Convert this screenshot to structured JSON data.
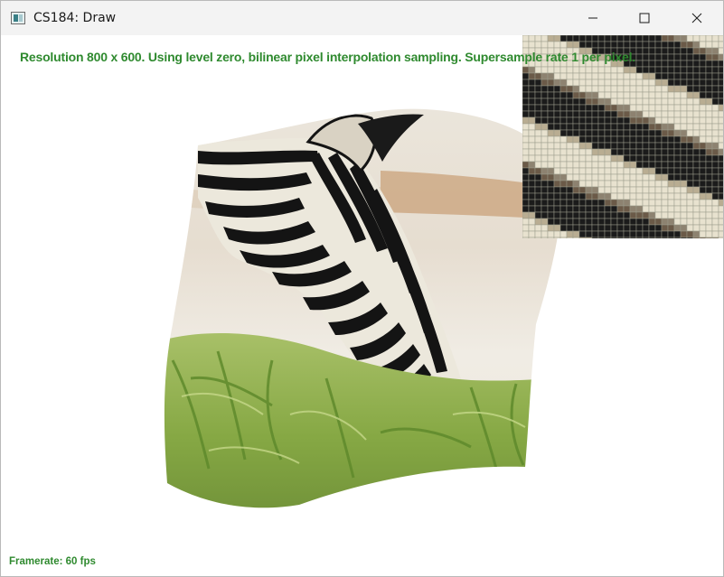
{
  "window": {
    "title": "CS184: Draw",
    "controls": {
      "minimize": "minimize-icon",
      "maximize": "maximize-icon",
      "close": "close-icon"
    }
  },
  "overlay": {
    "status_text": "Resolution 800 x 600. Using level zero, bilinear pixel interpolation sampling. Supersample rate 1 per pixel.",
    "framerate_text": "Framerate: 60 fps"
  },
  "scene": {
    "image_subject": "zebra-grazing",
    "colors": {
      "text_green": "#2f8a2f",
      "zebra_black": "#141414",
      "zebra_white": "#ece8dc",
      "grass_green": "#8fb04a",
      "background_sand": "#efe9dd",
      "zoom_cream": "#e8e2cf",
      "zoom_dark": "#1b1b1b"
    }
  }
}
